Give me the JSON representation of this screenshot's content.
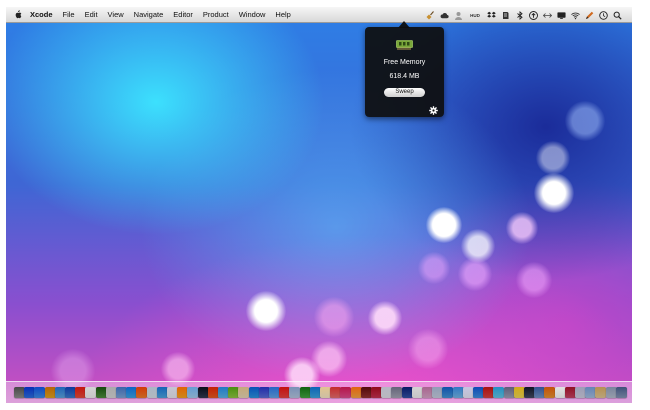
{
  "menubar": {
    "apple_icon": "apple-icon",
    "app_name": "Xcode",
    "items": [
      "File",
      "Edit",
      "View",
      "Navigate",
      "Editor",
      "Product",
      "Window",
      "Help"
    ],
    "status_badge": "HUD",
    "status_icons": [
      "broom-icon",
      "cloud-icon",
      "user-icon",
      "hud-icon",
      "dropbox-icon",
      "evernote-icon",
      "bluetooth-icon",
      "upload-icon",
      "arrows-icon",
      "screen-icon",
      "wifi-icon",
      "pencil-icon",
      "clock-icon",
      "spotlight-icon"
    ]
  },
  "popover": {
    "title": "Free Memory",
    "value": "618.4 MB",
    "button_label": "Sweep",
    "chip_icon": "memory-chip-icon",
    "gear_icon": "gear-icon"
  },
  "desktop": {
    "wallpaper": "blue-pink-bokeh"
  },
  "dock": {
    "icon_colors": [
      "#888888",
      "#2b6cd8",
      "#3d88e0",
      "#d8a020",
      "#5aa0d8",
      "#3a78c8",
      "#e04a3a",
      "#e8e8e8",
      "#4a8a3a",
      "#d0d0d0",
      "#7aa0d0",
      "#3aa0e0",
      "#e87a2a",
      "#d0d8e0",
      "#4aa0d8",
      "#e0e0e8",
      "#f0a020",
      "#a0c8e8",
      "#303850",
      "#e05a20",
      "#5ab0e0",
      "#8ac040",
      "#e0d0b0",
      "#2a90d8",
      "#5a6ad0",
      "#60a0e0",
      "#e04040",
      "#b0c0d8",
      "#40a040",
      "#3aa0d8",
      "#f0e0c0",
      "#e06a6a",
      "#d84a8a",
      "#f0a040",
      "#903030",
      "#c03050",
      "#d8d8e0",
      "#a0a0b0",
      "#3050a0",
      "#e8e8e8",
      "#d0a0c0",
      "#c0c8d8",
      "#4090d0",
      "#70b0e0",
      "#e0e0f0",
      "#3a8ad8",
      "#d04040",
      "#60c0e0",
      "#9a9ab0",
      "#e8d050",
      "#404860",
      "#7090c0",
      "#e09030",
      "#f0f0f0",
      "#c04060",
      "#c8c8d8",
      "#a0b8d8",
      "#d8c090",
      "#b0b8c8",
      "#8090b0"
    ]
  },
  "colors": {
    "menubar": "#e6e6e6",
    "popover_bg": "#0e0e0e",
    "accent_green": "#8cc63f"
  }
}
